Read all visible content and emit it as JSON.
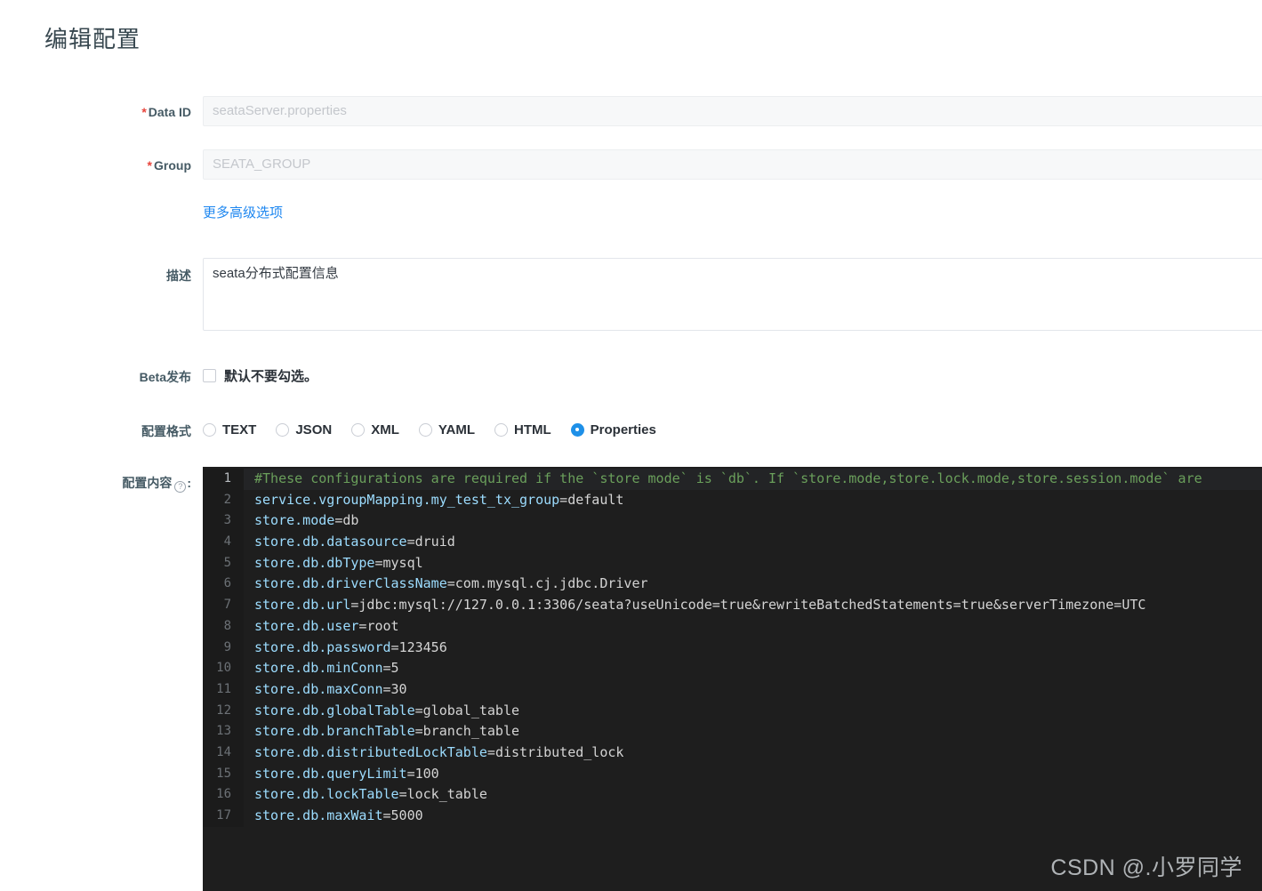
{
  "page": {
    "title": "编辑配置"
  },
  "form": {
    "data_id": {
      "label": "Data ID",
      "required_mark": "*",
      "value": "seataServer.properties"
    },
    "group": {
      "label": "Group",
      "required_mark": "*",
      "value": "SEATA_GROUP"
    },
    "advanced_link": "更多高级选项",
    "description": {
      "label": "描述",
      "value": "seata分布式配置信息"
    },
    "beta": {
      "label": "Beta发布",
      "checkbox_label": "默认不要勾选。",
      "checked": false
    },
    "format": {
      "label": "配置格式",
      "options": [
        {
          "label": "TEXT",
          "checked": false
        },
        {
          "label": "JSON",
          "checked": false
        },
        {
          "label": "XML",
          "checked": false
        },
        {
          "label": "YAML",
          "checked": false
        },
        {
          "label": "HTML",
          "checked": false
        },
        {
          "label": "Properties",
          "checked": true
        }
      ],
      "selected": "Properties"
    },
    "content": {
      "label": "配置内容",
      "help_icon": "question-circle-icon",
      "suffix": ":"
    }
  },
  "editor": {
    "language": "properties",
    "theme_bg": "#1e1e1e",
    "active_line": 1,
    "total_lines": 17,
    "lines": [
      {
        "n": 1,
        "type": "comment",
        "text": "#These configurations are required if the `store mode` is `db`. If `store.mode,store.lock.mode,store.session.mode` are"
      },
      {
        "n": 2,
        "type": "kv",
        "key": "service.vgroupMapping.my_test_tx_group",
        "value": "default"
      },
      {
        "n": 3,
        "type": "kv",
        "key": "store.mode",
        "value": "db"
      },
      {
        "n": 4,
        "type": "kv",
        "key": "store.db.datasource",
        "value": "druid"
      },
      {
        "n": 5,
        "type": "kv",
        "key": "store.db.dbType",
        "value": "mysql"
      },
      {
        "n": 6,
        "type": "kv",
        "key": "store.db.driverClassName",
        "value": "com.mysql.cj.jdbc.Driver"
      },
      {
        "n": 7,
        "type": "kv",
        "key": "store.db.url",
        "value": "jdbc:mysql://127.0.0.1:3306/seata?useUnicode=true&rewriteBatchedStatements=true&serverTimezone=UTC"
      },
      {
        "n": 8,
        "type": "kv",
        "key": "store.db.user",
        "value": "root"
      },
      {
        "n": 9,
        "type": "kv",
        "key": "store.db.password",
        "value": "123456"
      },
      {
        "n": 10,
        "type": "kv",
        "key": "store.db.minConn",
        "value": "5"
      },
      {
        "n": 11,
        "type": "kv",
        "key": "store.db.maxConn",
        "value": "30"
      },
      {
        "n": 12,
        "type": "kv",
        "key": "store.db.globalTable",
        "value": "global_table"
      },
      {
        "n": 13,
        "type": "kv",
        "key": "store.db.branchTable",
        "value": "branch_table"
      },
      {
        "n": 14,
        "type": "kv",
        "key": "store.db.distributedLockTable",
        "value": "distributed_lock"
      },
      {
        "n": 15,
        "type": "kv",
        "key": "store.db.queryLimit",
        "value": "100"
      },
      {
        "n": 16,
        "type": "kv",
        "key": "store.db.lockTable",
        "value": "lock_table"
      },
      {
        "n": 17,
        "type": "kv",
        "key": "store.db.maxWait",
        "value": "5000"
      }
    ]
  },
  "watermark": "CSDN @.小罗同学",
  "colors": {
    "accent": "#1e90e8",
    "link": "#1e87f0",
    "required": "#e8453c",
    "label": "#455a64",
    "editor_bg": "#1e1e1e",
    "comment": "#6a9f5b",
    "key": "#9cdcfe",
    "value": "#d4d4d4"
  }
}
